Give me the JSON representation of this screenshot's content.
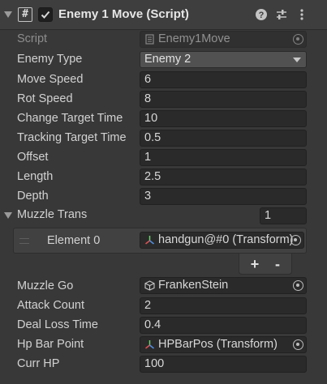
{
  "header": {
    "script_icon_glyph": "#",
    "title": "Enemy 1 Move (Script)",
    "enabled": true,
    "icons": [
      "foldout-arrow-icon",
      "script-icon",
      "help-icon",
      "preset-sliders-icon",
      "kebab-menu-icon"
    ]
  },
  "fields": [
    {
      "label": "Script",
      "value": "Enemy1Move",
      "kind": "script"
    },
    {
      "label": "Enemy Type",
      "value": "Enemy 2",
      "kind": "dropdown"
    },
    {
      "label": "Move Speed",
      "value": "6"
    },
    {
      "label": "Rot Speed",
      "value": "8"
    },
    {
      "label": "Change Target Time",
      "value": "10"
    },
    {
      "label": "Tracking Target Time",
      "value": "0.5"
    },
    {
      "label": "Offset",
      "value": "1"
    },
    {
      "label": "Length",
      "value": "2.5"
    },
    {
      "label": "Depth",
      "value": "3"
    }
  ],
  "muzzle_trans": {
    "label": "Muzzle Trans",
    "size": "1",
    "elements": [
      {
        "label": "Element 0",
        "value": "handgun@#0 (Transform)"
      }
    ],
    "add_label": "+",
    "remove_label": "-"
  },
  "fields2": [
    {
      "label": "Muzzle Go",
      "value": "FrankenStein",
      "kind": "gameobject"
    },
    {
      "label": "Attack Count",
      "value": "2"
    },
    {
      "label": "Deal Loss Time",
      "value": "0.4"
    },
    {
      "label": "Hp Bar Point",
      "value": "HPBarPos (Transform)",
      "kind": "transform"
    },
    {
      "label": "Curr HP",
      "value": "100"
    }
  ]
}
